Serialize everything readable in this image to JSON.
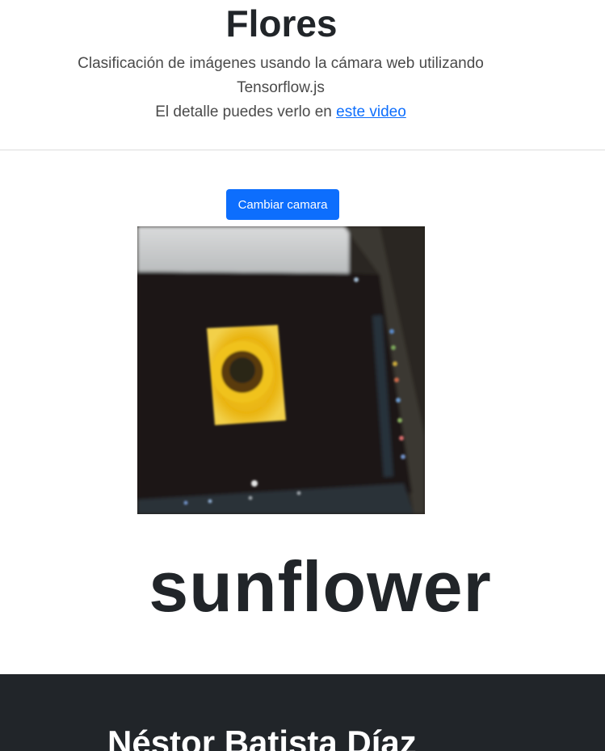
{
  "header": {
    "title": "Flores",
    "subtitle_line1": "Clasificación de imágenes usando la cámara web utilizando Tensorflow.js",
    "subtitle_line2_prefix": "El detalle puedes verlo en ",
    "video_link_text": "este video"
  },
  "controls": {
    "switch_camera_label": "Cambiar camara"
  },
  "result": {
    "prediction_label": "sunflower"
  },
  "footer": {
    "author_name": "Néstor Batista Díaz"
  },
  "colors": {
    "primary_button": "#0d6efd",
    "footer_background": "#212529",
    "link": "#0d6efd",
    "text": "#212529"
  }
}
